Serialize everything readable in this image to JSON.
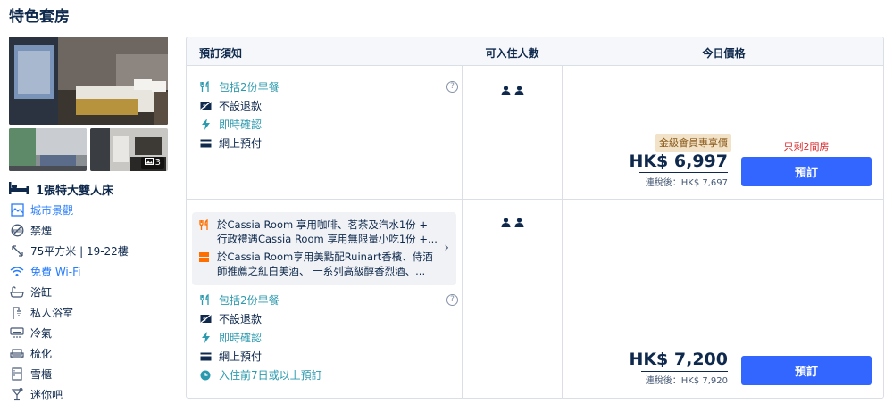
{
  "section_title": "特色套房",
  "photos": {
    "more_count": "3"
  },
  "room": {
    "bed": "1張特大雙人床",
    "amenities": [
      {
        "icon": "city-view-icon",
        "label": "城市景觀",
        "highlight": true
      },
      {
        "icon": "no-smoking-icon",
        "label": "禁煙",
        "highlight": false
      },
      {
        "icon": "area-icon",
        "label": "75平方米 | 19-22樓",
        "highlight": false
      },
      {
        "icon": "wifi-icon",
        "label": "免費 Wi-Fi",
        "highlight": true
      },
      {
        "icon": "bathtub-icon",
        "label": "浴缸",
        "highlight": false
      },
      {
        "icon": "shower-icon",
        "label": "私人浴室",
        "highlight": false
      },
      {
        "icon": "aircon-icon",
        "label": "冷氣",
        "highlight": false
      },
      {
        "icon": "toiletries-icon",
        "label": "梳化",
        "highlight": false
      },
      {
        "icon": "fridge-icon",
        "label": "雪櫃",
        "highlight": false
      },
      {
        "icon": "minibar-icon",
        "label": "迷你吧",
        "highlight": false
      }
    ]
  },
  "table": {
    "headers": {
      "policy": "預訂須知",
      "guests": "可入住人數",
      "price": "今日價格"
    }
  },
  "offers": [
    {
      "breakfast": "包括2份早餐",
      "refund": "不設退款",
      "confirm": "即時確認",
      "payment": "網上預付",
      "member_badge": "金級會員專享價",
      "price": "HK$ 6,997",
      "tax": "連稅後：HK$ 7,697",
      "rooms_left": "只剩2間房",
      "book": "預訂"
    },
    {
      "perk1": "於Cassia Room 享用咖啡、茗茶及汽水1份 + 行政禮遇Cassia Room 享用無限量小吃1份 +...",
      "perk2": "於Cassia Room享用美點配Ruinart香檳、侍酒師推薦之紅白美酒、 一系列高級醇香烈酒、...",
      "breakfast": "包括2份早餐",
      "refund": "不設退款",
      "confirm": "即時確認",
      "payment": "網上預付",
      "advance": "入住前7日或以上預訂",
      "price": "HK$ 7,200",
      "tax": "連稅後：HK$ 7,920",
      "book": "預訂"
    }
  ],
  "colors": {
    "accent": "#3366ff",
    "link": "#287dfa",
    "teal": "#2b9aae",
    "warning": "#d9292d",
    "badge_bg": "#f2e3c8"
  }
}
